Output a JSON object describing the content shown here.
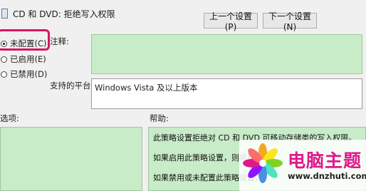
{
  "window": {
    "title": "CD 和 DVD: 拒绝写入权限"
  },
  "nav": {
    "prev_label": "上一个设置(P)",
    "next_label": "下一个设置(N)"
  },
  "state_options": [
    {
      "label": "未配置(C)",
      "checked": true
    },
    {
      "label": "已启用(E)",
      "checked": false
    },
    {
      "label": "已禁用(D)",
      "checked": false
    }
  ],
  "labels": {
    "note": "注释:",
    "platform": "支持的平台:",
    "options": "选项:",
    "help": "帮助:"
  },
  "note_value": "",
  "platform_value": "Windows Vista 及以上版本",
  "help_paragraphs": [
    "此策略设置拒绝对 CD 和 DVD 可移动存储类的写入权限。",
    "如果启用此策略设置，则将拒绝",
    "如果禁用或未配置此策略设置，"
  ],
  "watermark": {
    "title": "电脑主题",
    "url": "www.dnzhuti.com"
  },
  "colors": {
    "panel_green": "#c8ebc8",
    "highlight": "#d81560",
    "watermark": "#e0188c"
  }
}
